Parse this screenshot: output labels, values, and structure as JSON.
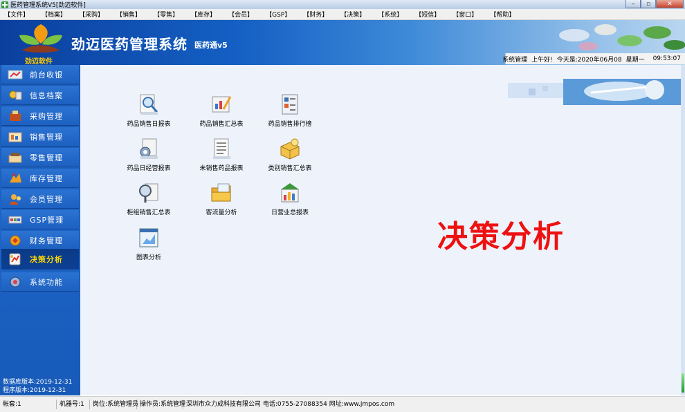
{
  "window": {
    "title": "医药管理系统V5[劲迈软件]",
    "buttons": {
      "minimize": "–",
      "maximize": "▫",
      "close": "✕"
    }
  },
  "menu": [
    "【文件】",
    "【档案】",
    "【采购】",
    "【销售】",
    "【零售】",
    "【库存】",
    "【会员】",
    "【GSP】",
    "【财务】",
    "【决策】",
    "【系统】",
    "【短信】",
    "【窗口】",
    "【帮助】"
  ],
  "header": {
    "logo_text": "劲迈软件",
    "app_title": "劲迈医药管理系统",
    "app_subtitle": "医药通v5",
    "status": {
      "user": "系统管理",
      "greeting": "上午好!",
      "date": "今天是:2020年06月08",
      "weekday": "星期一",
      "time": "09:53:07"
    }
  },
  "sidebar": {
    "items": [
      {
        "label": "前台收银",
        "icon": "cashier-icon",
        "active": false
      },
      {
        "label": "信息档案",
        "icon": "archive-icon",
        "active": false
      },
      {
        "label": "采购管理",
        "icon": "purchase-icon",
        "active": false
      },
      {
        "label": "销售管理",
        "icon": "sales-icon",
        "active": false
      },
      {
        "label": "零售管理",
        "icon": "retail-icon",
        "active": false
      },
      {
        "label": "库存管理",
        "icon": "inventory-icon",
        "active": false
      },
      {
        "label": "会员管理",
        "icon": "member-icon",
        "active": false
      },
      {
        "label": "GSP管理",
        "icon": "gsp-icon",
        "active": false
      },
      {
        "label": "财务管理",
        "icon": "finance-icon",
        "active": false
      },
      {
        "label": "决策分析",
        "icon": "decision-icon",
        "active": true
      },
      {
        "label": "系统功能",
        "icon": "system-icon",
        "active": false
      }
    ],
    "db_version": "数据库版本:2019-12-31",
    "app_version": "程序版本:2019-12-31"
  },
  "reports": [
    {
      "label": "药品销售日报表",
      "icon": "magnifier-report-icon"
    },
    {
      "label": "药品销售汇总表",
      "icon": "pencil-chart-icon"
    },
    {
      "label": "药品销售排行榜",
      "icon": "ranking-icon"
    },
    {
      "label": "药品日经营报表",
      "icon": "gear-report-icon"
    },
    {
      "label": "未销售药品报表",
      "icon": "document-list-icon"
    },
    {
      "label": "类别销售汇总表",
      "icon": "category-box-icon"
    },
    {
      "label": "柜组销售汇总表",
      "icon": "counter-group-icon"
    },
    {
      "label": "客流量分析",
      "icon": "folder-flow-icon"
    },
    {
      "label": "日营业总报表",
      "icon": "bar-chart-icon"
    },
    {
      "label": "图表分析",
      "icon": "chart-window-icon"
    }
  ],
  "main_title": "决策分析",
  "statusbar": {
    "account": "帐套:1",
    "machine": "机器号:1",
    "post": "岗位:系统管理员",
    "operator": "操作员:系统管理",
    "company": "深圳市众力成科技有限公司 电话:0755-27088354 网址:www.jmpos.com"
  },
  "colors": {
    "accent_blue": "#1d60c0",
    "active_nav": "#0c3f93",
    "active_text": "#ffd800",
    "title_red": "#ee1111"
  }
}
